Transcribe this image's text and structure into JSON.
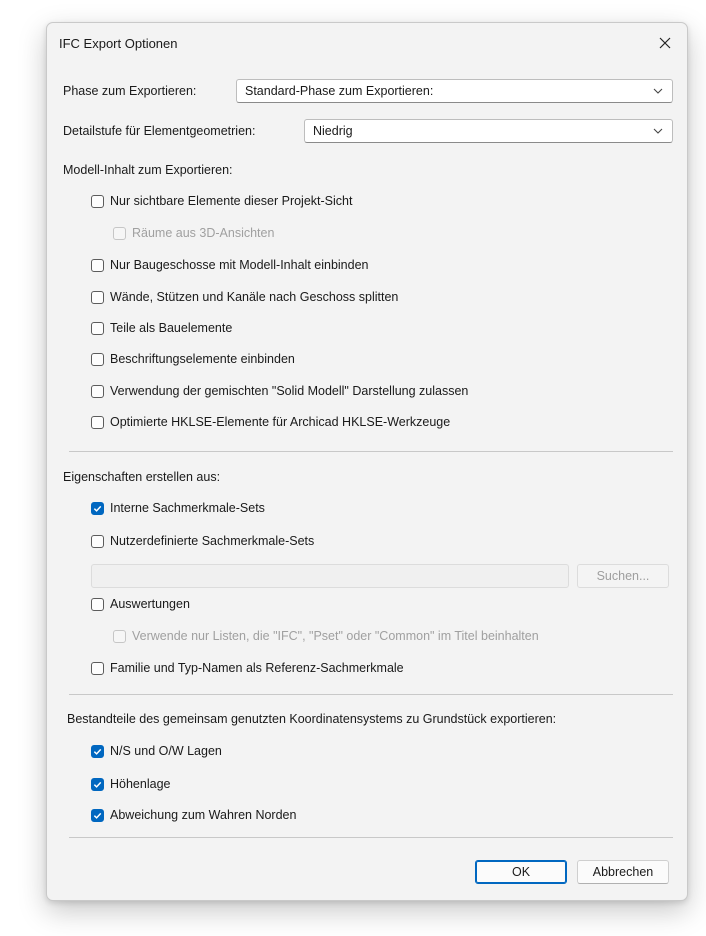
{
  "dialog": {
    "title": "IFC Export Optionen",
    "close_icon": "close-icon"
  },
  "phase": {
    "label": "Phase zum Exportieren:",
    "value": "Standard-Phase zum Exportieren:"
  },
  "detail": {
    "label": "Detailstufe für Elementgeometrien:",
    "value": "Niedrig"
  },
  "model_content": {
    "heading": "Modell-Inhalt zum Exportieren:",
    "options": [
      {
        "label": "Nur sichtbare Elemente dieser Projekt-Sicht",
        "checked": false,
        "enabled": true
      },
      {
        "label": "Räume aus 3D-Ansichten",
        "checked": false,
        "enabled": false
      },
      {
        "label": "Nur Baugeschosse mit Modell-Inhalt einbinden",
        "checked": false,
        "enabled": true
      },
      {
        "label": "Wände, Stützen und Kanäle nach Geschoss splitten",
        "checked": false,
        "enabled": true
      },
      {
        "label": "Teile als Bauelemente",
        "checked": false,
        "enabled": true
      },
      {
        "label": "Beschriftungselemente einbinden",
        "checked": false,
        "enabled": true
      },
      {
        "label": "Verwendung der gemischten \"Solid Modell\" Darstellung zulassen",
        "checked": false,
        "enabled": true
      },
      {
        "label": "Optimierte HKLSE-Elemente für Archicad HKLSE-Werkzeuge",
        "checked": false,
        "enabled": true
      }
    ]
  },
  "properties": {
    "heading": "Eigenschaften erstellen aus:",
    "options": [
      {
        "label": "Interne Sachmerkmale-Sets",
        "checked": true,
        "enabled": true
      },
      {
        "label": "Nutzerdefinierte Sachmerkmale-Sets",
        "checked": false,
        "enabled": true
      },
      {
        "label": "Auswertungen",
        "checked": false,
        "enabled": true
      },
      {
        "label": "Verwende nur Listen, die \"IFC\", \"Pset\" oder \"Common\" im Titel beinhalten",
        "checked": false,
        "enabled": false
      },
      {
        "label": "Familie und Typ-Namen als Referenz-Sachmerkmale",
        "checked": false,
        "enabled": true
      }
    ],
    "path_value": "",
    "browse_label": "Suchen..."
  },
  "coordinates": {
    "heading": "Bestandteile des gemeinsam genutzten Koordinatensystems zu Grundstück exportieren:",
    "options": [
      {
        "label": "N/S und O/W Lagen",
        "checked": true,
        "enabled": true
      },
      {
        "label": "Höhenlage",
        "checked": true,
        "enabled": true
      },
      {
        "label": "Abweichung zum Wahren Norden",
        "checked": true,
        "enabled": true
      }
    ]
  },
  "buttons": {
    "ok": "OK",
    "cancel": "Abbrechen"
  },
  "colors": {
    "accent": "#0067c0",
    "dialog_bg": "#f3f3f3"
  }
}
